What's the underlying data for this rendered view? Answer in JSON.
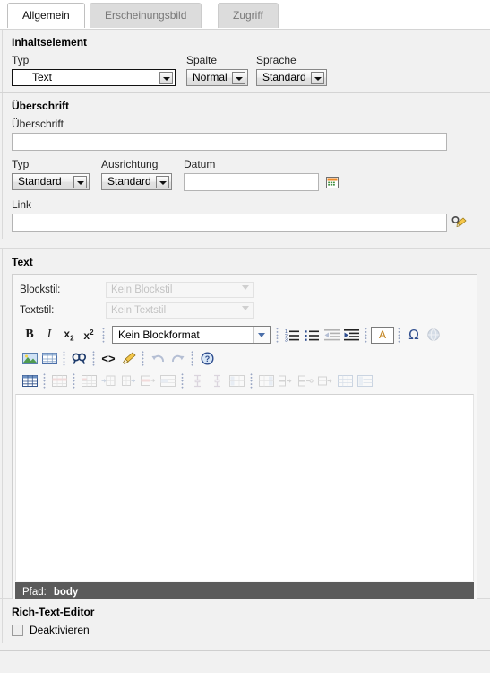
{
  "tabs": [
    {
      "label": "Allgemein",
      "active": true
    },
    {
      "label": "Erscheinungsbild",
      "active": false
    },
    {
      "label": "Zugriff",
      "active": false
    }
  ],
  "content_element": {
    "title": "Inhaltselement",
    "type_label": "Typ",
    "type_value": "Text",
    "column_label": "Spalte",
    "column_value": "Normal",
    "language_label": "Sprache",
    "language_value": "Standard"
  },
  "header": {
    "title": "Überschrift",
    "headline_label": "Überschrift",
    "headline_value": "",
    "type_label": "Typ",
    "type_value": "Standard",
    "align_label": "Ausrichtung",
    "align_value": "Standard",
    "date_label": "Datum",
    "date_value": "",
    "date_picker_icon": "calendar-icon",
    "link_label": "Link",
    "link_value": "",
    "link_wizard_icon": "link-wizard-icon"
  },
  "text": {
    "title": "Text",
    "blockstyle_label": "Blockstil:",
    "blockstyle_value": "Kein Blockstil",
    "textstyle_label": "Textstil:",
    "textstyle_value": "Kein Textstil",
    "blockformat_value": "Kein Blockformat",
    "editor_value": "",
    "status_prefix": "Pfad:",
    "status_path": "body",
    "toolbar_row1": [
      {
        "icon": "bold-icon",
        "disabled": false
      },
      {
        "icon": "italic-icon",
        "disabled": false
      },
      {
        "icon": "subscript-icon",
        "disabled": false
      },
      {
        "icon": "superscript-icon",
        "disabled": false
      },
      {
        "icon": "ordered-list-icon",
        "disabled": false
      },
      {
        "icon": "unordered-list-icon",
        "disabled": false
      },
      {
        "icon": "outdent-icon",
        "disabled": true
      },
      {
        "icon": "indent-icon",
        "disabled": false
      },
      {
        "icon": "text-color-icon",
        "disabled": false
      },
      {
        "icon": "special-character-icon",
        "disabled": false
      },
      {
        "icon": "insert-link-globe-icon",
        "disabled": true
      }
    ],
    "toolbar_row2": [
      {
        "icon": "insert-image-icon",
        "disabled": false
      },
      {
        "icon": "insert-table-icon",
        "disabled": false
      },
      {
        "icon": "find-replace-icon",
        "disabled": false
      },
      {
        "icon": "source-code-icon",
        "disabled": false
      },
      {
        "icon": "clean-html-icon",
        "disabled": false
      },
      {
        "icon": "undo-icon",
        "disabled": true
      },
      {
        "icon": "redo-icon",
        "disabled": true
      },
      {
        "icon": "help-icon",
        "disabled": false
      }
    ],
    "toolbar_row3": [
      {
        "icon": "table-properties-icon",
        "disabled": false
      },
      {
        "icon": "row-properties-icon",
        "disabled": true
      },
      {
        "icon": "cell-properties-icon",
        "disabled": true
      },
      {
        "icon": "insert-row-before-icon",
        "disabled": true
      },
      {
        "icon": "insert-row-after-icon",
        "disabled": true
      },
      {
        "icon": "delete-row-icon",
        "disabled": true
      },
      {
        "icon": "split-cell-icon",
        "disabled": true
      },
      {
        "icon": "merge-cells-icon",
        "disabled": true
      },
      {
        "icon": "split-table-icon",
        "disabled": true
      },
      {
        "icon": "insert-column-before-icon",
        "disabled": true
      },
      {
        "icon": "insert-column-after-icon",
        "disabled": true
      },
      {
        "icon": "delete-column-icon",
        "disabled": true
      },
      {
        "icon": "table-row-up-icon",
        "disabled": true
      },
      {
        "icon": "table-row-down-icon",
        "disabled": true
      },
      {
        "icon": "table-cell-split-icon",
        "disabled": true
      },
      {
        "icon": "table-grid-icon",
        "disabled": true
      },
      {
        "icon": "table-caption-icon",
        "disabled": true
      }
    ]
  },
  "rich_text_editor": {
    "title": "Rich-Text-Editor",
    "disable_label": "Deaktivieren",
    "disable_checked": false
  },
  "colors": {
    "page_bg": "#f1f1f1",
    "active_tab_bg": "#ffffff",
    "inactive_tab_bg": "#dcdcdc",
    "status_bar_bg": "#5b5b5b",
    "accent_blue": "#2e4d8e"
  }
}
